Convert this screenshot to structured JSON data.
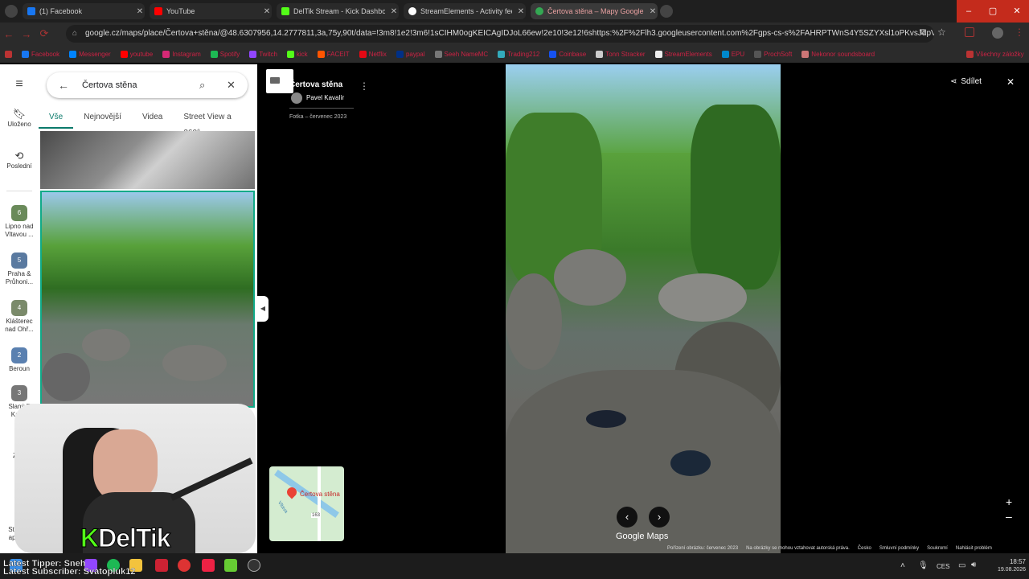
{
  "tabs": [
    {
      "label": "(1) Facebook",
      "color": "#1877f2"
    },
    {
      "label": "YouTube",
      "color": "#ff0000"
    },
    {
      "label": "DelTik Stream - Kick Dashboard",
      "color": "#53fc18"
    },
    {
      "label": "StreamElements - Activity feed",
      "color": "#ffffff"
    },
    {
      "label": "Čertova stěna – Mapy Google",
      "color": "#34a853"
    }
  ],
  "url": "google.cz/maps/place/Čertova+stěna/@48.6307956,14.2777811,3a,75y,90t/data=!3m8!1e2!3m6!1sCIHM0ogKEICAgIDJoL66ew!2e10!3e12!6shttps:%2F%2Flh3.googleusercontent.com%2Fgps-cs-s%2FAHRPTWnS4Y5SZYXsl1oPKvsJdpViE_65YgXJoAOvq...",
  "bookmarks": [
    "Facebook",
    "Messenger",
    "youtube",
    "Instagram",
    "Spotify",
    "Twitch",
    "kick",
    "FACEIT",
    "Netflix",
    "paypal",
    "Seeh NameMC",
    "Trading212",
    "Coinbase",
    "Tonn Stracker",
    "StreamElements",
    "EPU",
    "ProchSoft",
    "Nekonor soundsboard",
    "Všechny záložky"
  ],
  "rail": {
    "saved": "Uloženo",
    "recent": "Poslední",
    "places": [
      {
        "label": "Lipno nad Vltavou ...",
        "count": "6"
      },
      {
        "label": "Praha & Průhoni...",
        "count": "5"
      },
      {
        "label": "Klášterec nad Ohř...",
        "count": "4"
      },
      {
        "label": "Beroun",
        "count": "2"
      },
      {
        "label": "Slaný F Kač...",
        "count": "3"
      },
      {
        "label": "Zo...",
        "count": ""
      }
    ],
    "apps": "Stáhn... aplikaci"
  },
  "search": {
    "value": "Čertova stěna"
  },
  "panel_tabs": [
    "Vše",
    "Nejnovější",
    "Videa",
    "Street View a 360°"
  ],
  "photo_info": {
    "place": "Čertova stěna",
    "author": "Pavel Kavalír",
    "date": "Fotka – červenec 2023"
  },
  "share": "Sdílet",
  "minimap_label": "Čertova stěna",
  "minimap_road": "163",
  "minimap_river": "Vltava",
  "watermark": "Google Maps",
  "footer": {
    "captured": "Pořízení obrázku: červenec 2023",
    "copyright": "Na obrázky se mohou vztahovat autorská práva.",
    "links": [
      "Česko",
      "Smluvní podmínky",
      "Soukromí",
      "Nahlásit problém"
    ]
  },
  "overlay": {
    "tipper": "Latest Tipper: Sneh",
    "subscriber": "Latest Subscriber: Svatopluk12",
    "brand": "DelTik",
    "brand_color": "#53fc18"
  },
  "taskbar": {
    "lang": "CES",
    "time": "18:57",
    "date": "19.08.2026"
  }
}
